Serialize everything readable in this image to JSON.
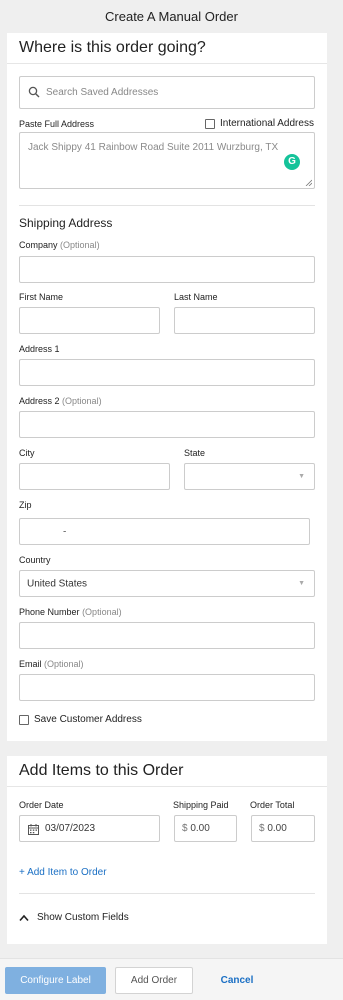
{
  "header": {
    "title": "Create A Manual Order"
  },
  "destination": {
    "title": "Where is this order going?",
    "search_placeholder": "Search Saved Addresses",
    "paste_label": "Paste Full Address",
    "international_label": "International Address",
    "paste_value": "Jack Shippy 41 Rainbow Road Suite 2011 Wurzburg, TX"
  },
  "shipping": {
    "heading": "Shipping Address",
    "company_label": "Company",
    "optional": "(Optional)",
    "first_name_label": "First Name",
    "last_name_label": "Last Name",
    "address1_label": "Address 1",
    "address2_label": "Address 2",
    "city_label": "City",
    "state_label": "State",
    "zip_label": "Zip",
    "zip_dash": "-",
    "country_label": "Country",
    "country_value": "United States",
    "phone_label": "Phone Number",
    "email_label": "Email",
    "save_customer_label": "Save Customer Address"
  },
  "items": {
    "title": "Add Items to this Order",
    "order_date_label": "Order Date",
    "order_date_value": "03/07/2023",
    "shipping_paid_label": "Shipping Paid",
    "shipping_paid_value": "0.00",
    "order_total_label": "Order Total",
    "order_total_value": "0.00",
    "currency": "$",
    "add_item_link": "+ Add Item to Order",
    "custom_fields_toggle": "Show Custom Fields"
  },
  "footer": {
    "configure_label": "Configure Label",
    "add_order": "Add Order",
    "cancel": "Cancel"
  },
  "colors": {
    "accent": "#1a6fc4",
    "primary_button": "#7fb0e0",
    "grammarly": "#15c39a",
    "background": "#efefef"
  },
  "icons": [
    "search-icon",
    "calendar-icon",
    "chevron-up-icon",
    "grammarly-icon",
    "chevron-down-icon"
  ]
}
